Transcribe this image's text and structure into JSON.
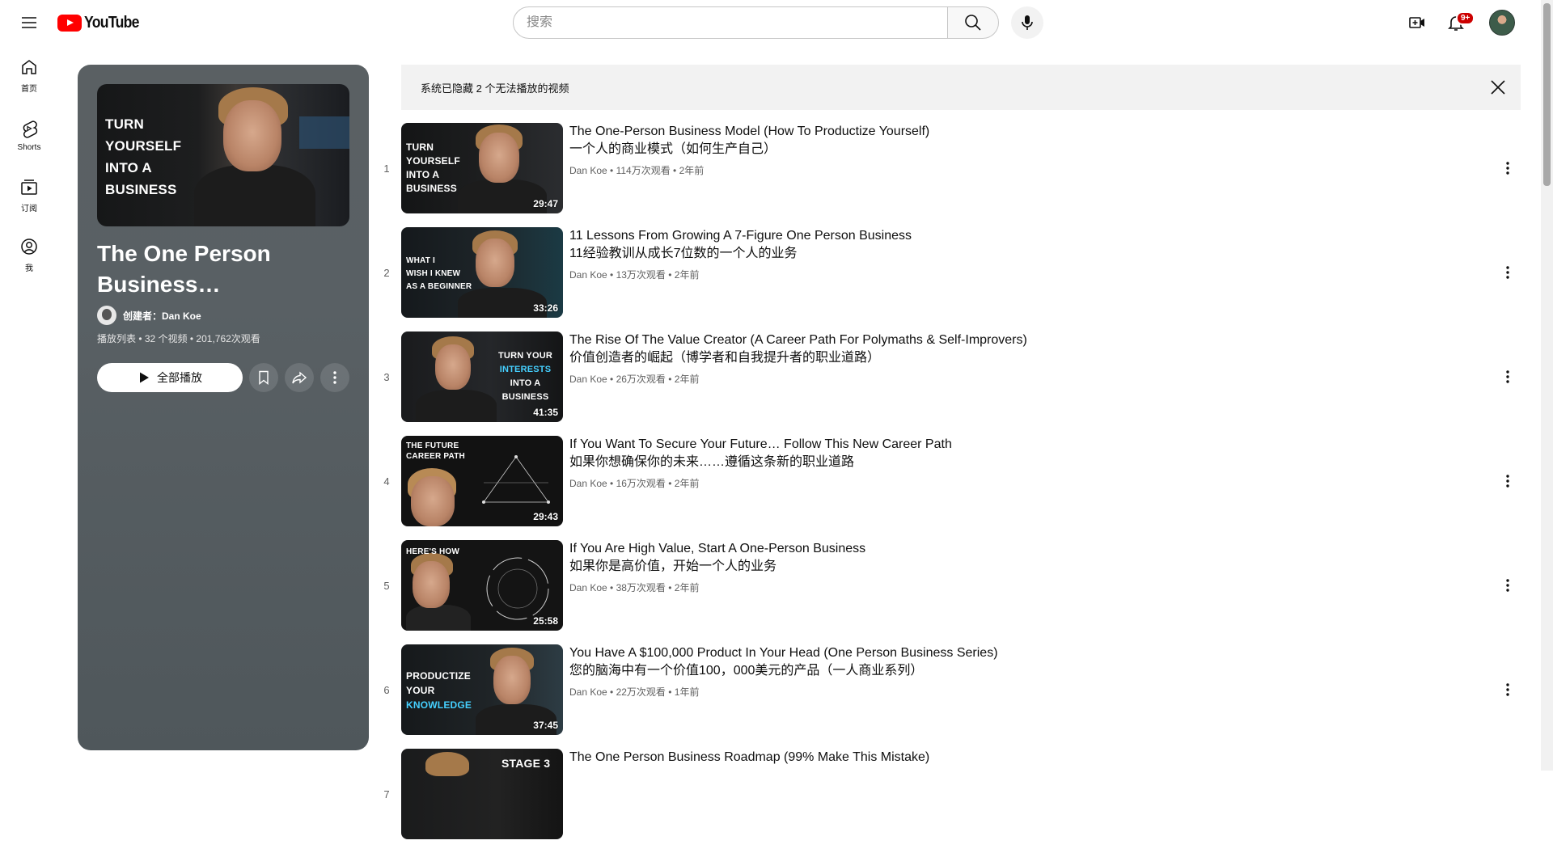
{
  "header": {
    "logo_text": "YouTube",
    "search_placeholder": "搜索",
    "notification_count": "9+"
  },
  "guide": {
    "items": [
      {
        "label": "首页",
        "icon": "home-icon"
      },
      {
        "label": "Shorts",
        "icon": "shorts-icon"
      },
      {
        "label": "订阅",
        "icon": "subscriptions-icon"
      },
      {
        "label": "我",
        "icon": "you-icon"
      }
    ]
  },
  "playlist": {
    "thumb_caption": [
      "TURN",
      "YOURSELF",
      "INTO A",
      "BUSINESS"
    ],
    "title": "The One Person Business…",
    "owner": "创建者：Dan Koe",
    "meta": "播放列表 • 32 个视频 • 201,762次观看",
    "play_all_label": "全部播放"
  },
  "notice": {
    "text": "系统已隐藏 2 个无法播放的视频"
  },
  "videos": [
    {
      "index": "1",
      "title": "The One-Person Business Model (How To Productize Yourself)",
      "subtitle": "一个人的商业模式（如何生产自己）",
      "meta": "Dan Koe • 114万次观看 • 2年前",
      "duration": "29:47",
      "caption": "TURN\nYOURSELF\nINTO A\nBUSINESS"
    },
    {
      "index": "2",
      "title": "11 Lessons From Growing A 7-Figure One Person Business",
      "subtitle": "11经验教训从成长7位数的一个人的业务",
      "meta": "Dan Koe • 13万次观看 • 2年前",
      "duration": "33:26",
      "caption": "WHAT I\nWISH I KNEW\nAS A BEGINNER"
    },
    {
      "index": "3",
      "title": "The Rise Of The Value Creator (A Career Path For Polymaths & Self-Improvers)",
      "subtitle": "价值创造者的崛起（博学者和自我提升者的职业道路）",
      "meta": "Dan Koe • 26万次观看 • 2年前",
      "duration": "41:35",
      "caption": "TURN YOUR\nINTERESTS\nINTO A\nBUSINESS"
    },
    {
      "index": "4",
      "title": "If You Want To Secure Your Future… Follow This New Career Path",
      "subtitle": "如果你想确保你的未来……遵循这条新的职业道路",
      "meta": "Dan Koe • 16万次观看 • 2年前",
      "duration": "29:43",
      "caption": "THE FUTURE\nCAREER PATH"
    },
    {
      "index": "5",
      "title": "If You Are High Value, Start A One-Person Business",
      "subtitle": "如果你是高价值，开始一个人的业务",
      "meta": "Dan Koe • 38万次观看 • 2年前",
      "duration": "25:58",
      "caption": "HERE'S HOW"
    },
    {
      "index": "6",
      "title": "You Have A $100,000 Product In Your Head (One Person Business Series)",
      "subtitle": "您的脑海中有一个价值100，000美元的产品（一人商业系列）",
      "meta": "Dan Koe • 22万次观看 • 1年前",
      "duration": "37:45",
      "caption": "PRODUCTIZE\nYOUR\nKNOWLEDGE"
    },
    {
      "index": "7",
      "title": "The One Person Business Roadmap (99% Make This Mistake)",
      "subtitle": "",
      "meta": "",
      "duration": "",
      "caption": "STAGE 3"
    }
  ],
  "colors": {
    "brand_red": "#ff0000",
    "panel_bg": "#596064",
    "notice_bg": "#f2f2f2"
  }
}
